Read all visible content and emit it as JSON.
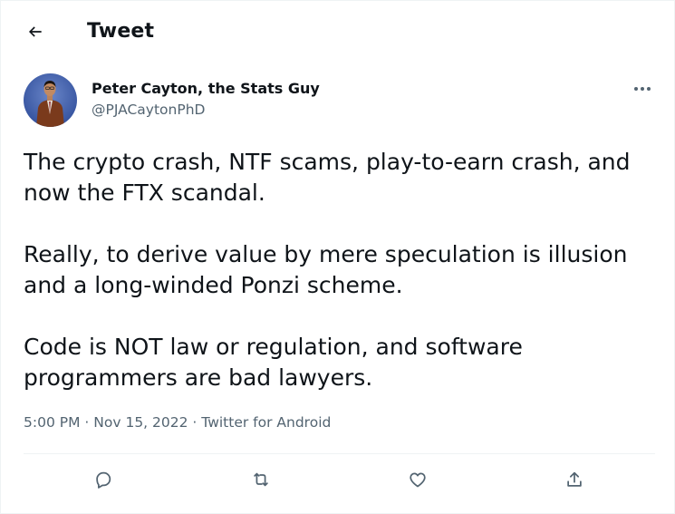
{
  "header": {
    "back_icon": "arrow-left-icon",
    "title": "Tweet"
  },
  "tweet": {
    "author": {
      "name": "Peter Cayton, the Stats Guy",
      "handle": "@PJACaytonPhD",
      "avatar": "avatar-photo"
    },
    "more_icon": "ellipsis-icon",
    "paragraphs": [
      [
        "The crypto crash, NTF scams, play-to-earn crash, and",
        "now the FTX scandal."
      ],
      [
        "Really, to derive value by mere speculation is illusion",
        "and a long-winded Ponzi scheme."
      ],
      [
        "Code is NOT law or regulation, and software",
        "programmers are bad lawyers."
      ]
    ],
    "time": "5:00 PM",
    "date": "Nov 15, 2022",
    "source": "Twitter for Android",
    "separator": "·",
    "actions": [
      "reply-icon",
      "retweet-icon",
      "like-icon",
      "share-icon"
    ]
  },
  "colors": {
    "text": "#0f1419",
    "muted": "#536471",
    "divider": "#eff3f4"
  }
}
